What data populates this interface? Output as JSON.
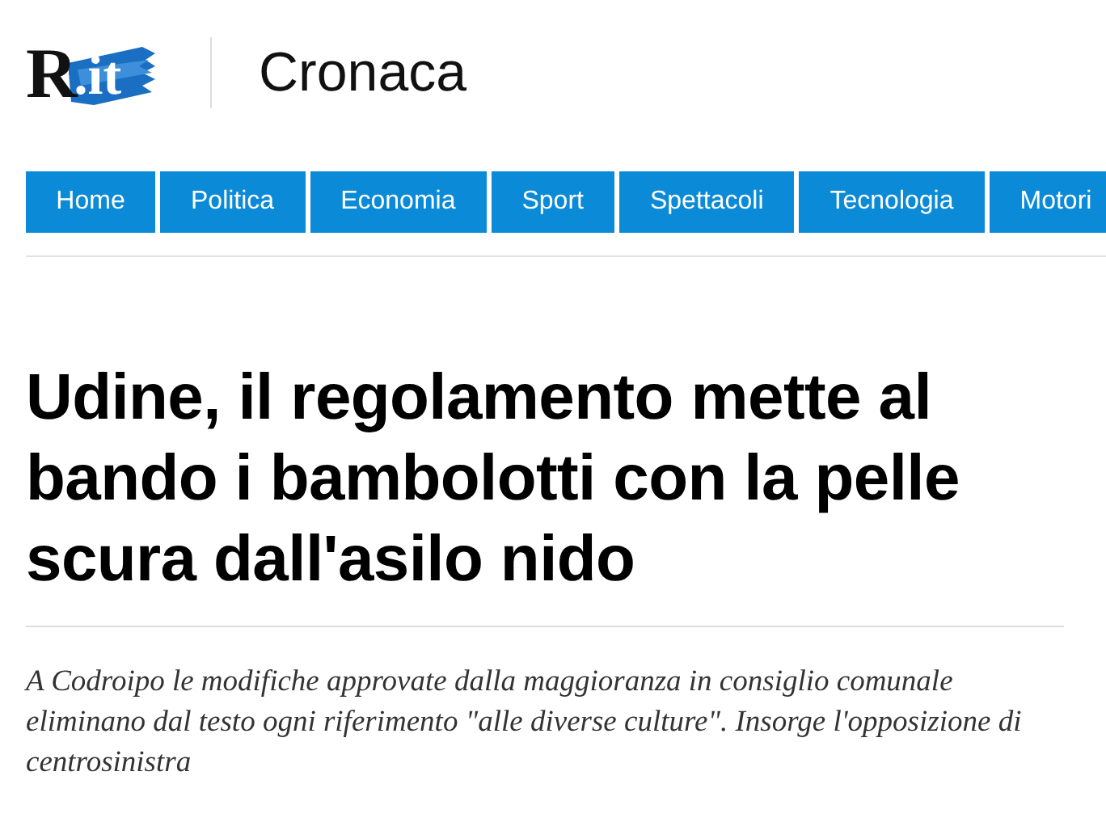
{
  "logo": {
    "letter": "R",
    "suffix": ".it"
  },
  "section_title": "Cronaca",
  "nav": [
    {
      "label": "Home"
    },
    {
      "label": "Politica"
    },
    {
      "label": "Economia"
    },
    {
      "label": "Sport"
    },
    {
      "label": "Spettacoli"
    },
    {
      "label": "Tecnologia"
    },
    {
      "label": "Motori"
    }
  ],
  "article": {
    "headline": "Udine, il regolamento mette al bando i bambolotti con la pelle scura dall'asilo nido",
    "summary": "A Codroipo le modifiche approvate dalla maggioranza in consiglio comunale eliminano dal testo ogni riferimento \"alle diverse culture\". Insorge l'opposizione di centrosinistra"
  }
}
